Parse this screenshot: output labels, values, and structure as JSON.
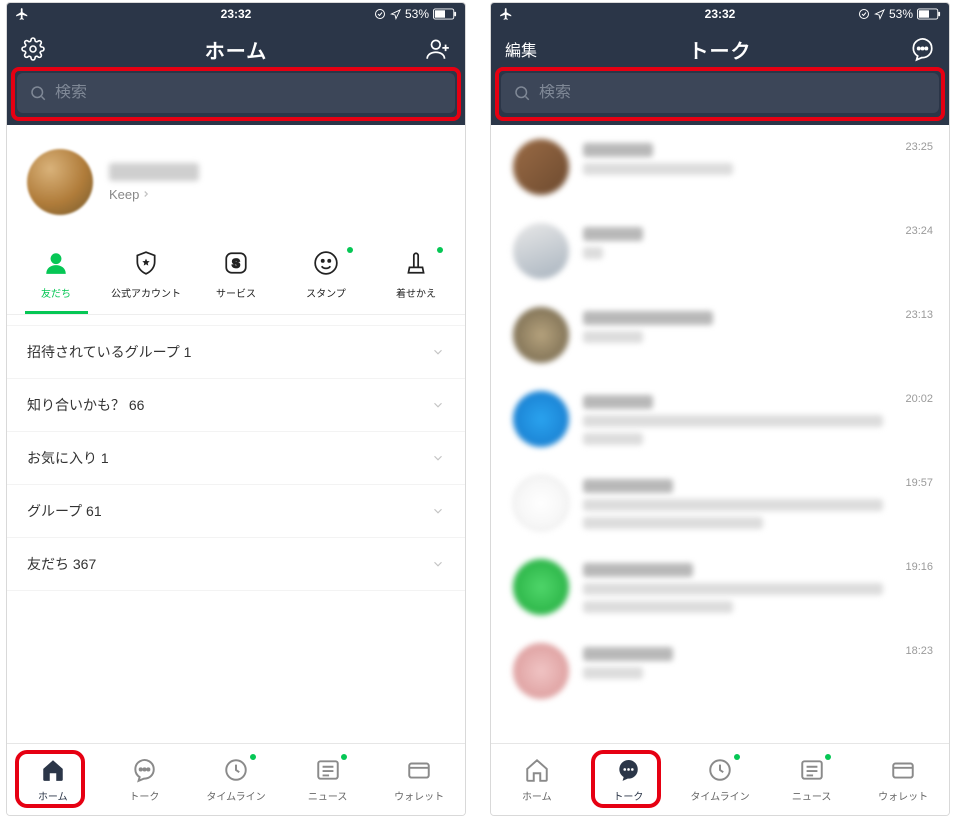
{
  "status": {
    "time": "23:32",
    "battery_text": "53%"
  },
  "left": {
    "title": "ホーム",
    "search_placeholder": "検索",
    "profile": {
      "keep": "Keep"
    },
    "htabs": [
      {
        "label": "友だち"
      },
      {
        "label": "公式アカウント"
      },
      {
        "label": "サービス"
      },
      {
        "label": "スタンプ"
      },
      {
        "label": "着せかえ"
      }
    ],
    "sections": [
      {
        "label": "招待されているグループ 1"
      },
      {
        "label": "知り合いかも？ 66"
      },
      {
        "label": "お気に入り 1"
      },
      {
        "label": "グループ 61"
      },
      {
        "label": "友だち 367"
      }
    ]
  },
  "right": {
    "edit": "編集",
    "title": "トーク",
    "search_placeholder": "検索",
    "chats": [
      {
        "time": "23:25",
        "avatar": "linear-gradient(135deg,#9a6b45,#6d4a2f)",
        "name_w": 70,
        "msg_w": 150
      },
      {
        "time": "23:24",
        "avatar": "linear-gradient(160deg,#e8e8e8,#a9b4bf)",
        "name_w": 60,
        "msg_w": 20
      },
      {
        "time": "23:13",
        "avatar": "radial-gradient(circle,#b5a27d,#6e6148)",
        "name_w": 130,
        "msg_w": 60
      },
      {
        "time": "20:02",
        "avatar": "radial-gradient(circle,#2aa3ef,#1576c9)",
        "name_w": 70,
        "msg_w": 300,
        "msg2_w": 60
      },
      {
        "time": "19:57",
        "avatar": "radial-gradient(circle,#ffffff,#f0f0f0)",
        "border": true,
        "name_w": 90,
        "msg_w": 300,
        "msg2_w": 180
      },
      {
        "time": "19:16",
        "avatar": "radial-gradient(circle,#4fd66a,#1fa83b)",
        "name_w": 110,
        "msg_w": 300,
        "msg2_w": 150
      },
      {
        "time": "18:23",
        "avatar": "radial-gradient(circle,#f0c4c4,#d89494)",
        "name_w": 90,
        "msg_w": 60
      }
    ]
  },
  "tabs": [
    {
      "label": "ホーム"
    },
    {
      "label": "トーク"
    },
    {
      "label": "タイムライン"
    },
    {
      "label": "ニュース"
    },
    {
      "label": "ウォレット"
    }
  ]
}
